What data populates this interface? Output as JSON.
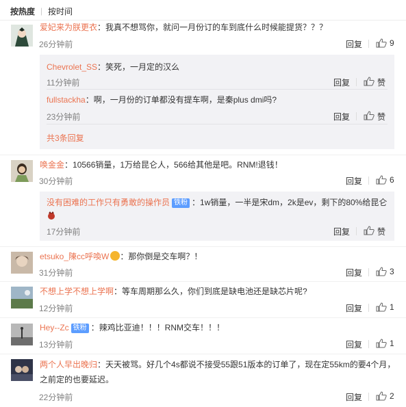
{
  "sort": {
    "hot_label": "按热度",
    "time_label": "按时间"
  },
  "comments": [
    {
      "user": "爱妃来为朕更衣",
      "text": "：我真不想骂你，就问一月份订的车到底什么时候能提货？？？",
      "time": "26分钟前",
      "reply_label": "回复",
      "likes": "9",
      "replies": [
        {
          "user": "Chevrolet_SS",
          "text": "：笑死，一月定的汉么",
          "time": "11分钟前",
          "reply_label": "回复",
          "like_label": "赞"
        },
        {
          "user": "fullstackha",
          "text": "：啊，一月份的订单都没有提车啊，是秦plus dmi吗?",
          "time": "23分钟前",
          "reply_label": "回复",
          "like_label": "赞"
        }
      ],
      "more_label": "共3条回复"
    },
    {
      "user": "唤金金",
      "text": "：10566销量，1万给昆仑人，566给其他是吧。RNM!退钱！",
      "time": "30分钟前",
      "reply_label": "回复",
      "likes": "6",
      "replies": [
        {
          "user": "没有困难的工作只有勇敢的操作员",
          "badge": "铁粉",
          "text": "：1w销量，一半是宋dm，2k是ev，剩下的80%给昆仑",
          "time": "17分钟前",
          "reply_label": "回复",
          "like_label": "赞"
        }
      ]
    },
    {
      "user": "etsuko_陳cc呼喚W",
      "text": "：那你倒是交车啊？！",
      "time": "31分钟前",
      "reply_label": "回复",
      "likes": "3"
    },
    {
      "user": "不想上学不想上学啊",
      "text": "：等车周期那么久，你们到底是缺电池还是缺芯片呢?",
      "time": "12分钟前",
      "reply_label": "回复",
      "likes": "1"
    },
    {
      "user": "Hey--Zc",
      "badge": "铁粉",
      "text": "：辣鸡比亚迪！！！RNM交车！！！",
      "time": "13分钟前",
      "reply_label": "回复",
      "likes": "1"
    },
    {
      "user": "两个人早出晚归",
      "text": "：天天被骂。好几个4s都说不接受55跟51版本的订单了，现在定55km的要4个月，",
      "text2": "之前定的也要延迟。",
      "time": "22分钟前",
      "reply_label": "回复",
      "likes": "2"
    }
  ],
  "colors": {
    "username": "#eb7350",
    "badge": "#5c9dff",
    "reply_bg": "#f2f2f5",
    "time": "#808080"
  }
}
